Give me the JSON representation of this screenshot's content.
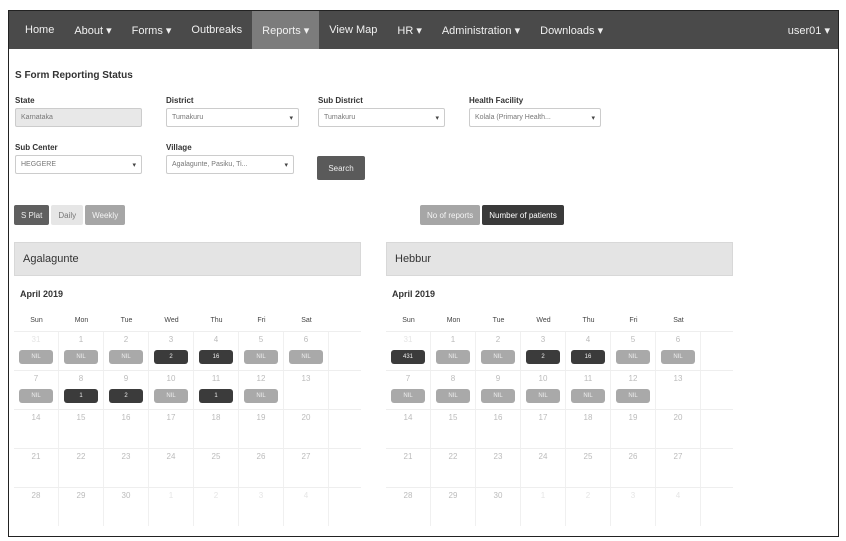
{
  "nav": {
    "items": [
      "Home",
      "About ▾",
      "Forms ▾",
      "Outbreaks",
      "Reports ▾",
      "View Map",
      "HR ▾",
      "Administration ▾",
      "Downloads ▾"
    ],
    "active_index": 4,
    "user": "user01 ▾"
  },
  "page": {
    "title": "S Form Reporting Status"
  },
  "form": {
    "state": {
      "label": "State",
      "value": "Karnataka"
    },
    "district": {
      "label": "District",
      "value": "Tumakuru"
    },
    "sub_district": {
      "label": "Sub District",
      "value": "Tumakuru"
    },
    "health_facility": {
      "label": "Health Facility",
      "value": "Kolala (Primary Health..."
    },
    "sub_center": {
      "label": "Sub Center",
      "value": "HEGGERE"
    },
    "village": {
      "label": "Village",
      "value": "Agalagunte, Pasiku, Ti..."
    },
    "search_label": "Search"
  },
  "view_toggle": [
    "S Plat",
    "Daily",
    "Weekly"
  ],
  "metric_toggle": [
    "No of reports",
    "Number of patients"
  ],
  "colors": {
    "nav_bg": "#4a4a4a",
    "badge_dark": "#3b3b3b",
    "badge_light": "#a9a9a9"
  },
  "calendars": [
    {
      "name": "Agalagunte",
      "month": "April 2019",
      "dow": [
        "Sun",
        "Mon",
        "Tue",
        "Wed",
        "Thu",
        "Fri",
        "Sat"
      ],
      "weeks": [
        [
          {
            "n": "31",
            "other": true,
            "badge": "NIL",
            "style": "light"
          },
          {
            "n": "1",
            "badge": "NIL",
            "style": "light"
          },
          {
            "n": "2",
            "badge": "NIL",
            "style": "light"
          },
          {
            "n": "3",
            "badge": "2",
            "style": "dark"
          },
          {
            "n": "4",
            "badge": "16",
            "style": "dark"
          },
          {
            "n": "5",
            "badge": "NIL",
            "style": "light"
          },
          {
            "n": "6",
            "badge": "NIL",
            "style": "light"
          }
        ],
        [
          {
            "n": "7",
            "badge": "NIL",
            "style": "light"
          },
          {
            "n": "8",
            "badge": "1",
            "style": "dark"
          },
          {
            "n": "9",
            "badge": "2",
            "style": "dark"
          },
          {
            "n": "10",
            "badge": "NIL",
            "style": "light"
          },
          {
            "n": "11",
            "badge": "1",
            "style": "dark"
          },
          {
            "n": "12",
            "badge": "NIL",
            "style": "light"
          },
          {
            "n": "13"
          }
        ],
        [
          {
            "n": "14"
          },
          {
            "n": "15"
          },
          {
            "n": "16"
          },
          {
            "n": "17"
          },
          {
            "n": "18"
          },
          {
            "n": "19"
          },
          {
            "n": "20"
          }
        ],
        [
          {
            "n": "21"
          },
          {
            "n": "22"
          },
          {
            "n": "23"
          },
          {
            "n": "24"
          },
          {
            "n": "25"
          },
          {
            "n": "26"
          },
          {
            "n": "27"
          }
        ],
        [
          {
            "n": "28"
          },
          {
            "n": "29"
          },
          {
            "n": "30"
          },
          {
            "n": "1",
            "other": true
          },
          {
            "n": "2",
            "other": true
          },
          {
            "n": "3",
            "other": true
          },
          {
            "n": "4",
            "other": true
          }
        ]
      ]
    },
    {
      "name": "Hebbur",
      "month": "April 2019",
      "dow": [
        "Sun",
        "Mon",
        "Tue",
        "Wed",
        "Thu",
        "Fri",
        "Sat"
      ],
      "weeks": [
        [
          {
            "n": "31",
            "other": true,
            "badge": "431",
            "style": "dark"
          },
          {
            "n": "1",
            "badge": "NIL",
            "style": "light"
          },
          {
            "n": "2",
            "badge": "NIL",
            "style": "light"
          },
          {
            "n": "3",
            "badge": "2",
            "style": "dark"
          },
          {
            "n": "4",
            "badge": "16",
            "style": "dark"
          },
          {
            "n": "5",
            "badge": "NIL",
            "style": "light"
          },
          {
            "n": "6",
            "badge": "NIL",
            "style": "light"
          }
        ],
        [
          {
            "n": "7",
            "badge": "NIL",
            "style": "light"
          },
          {
            "n": "8",
            "badge": "NIL",
            "style": "light"
          },
          {
            "n": "9",
            "badge": "NIL",
            "style": "light"
          },
          {
            "n": "10",
            "badge": "NIL",
            "style": "light"
          },
          {
            "n": "11",
            "badge": "NIL",
            "style": "light"
          },
          {
            "n": "12",
            "badge": "NIL",
            "style": "light"
          },
          {
            "n": "13"
          }
        ],
        [
          {
            "n": "14"
          },
          {
            "n": "15"
          },
          {
            "n": "16"
          },
          {
            "n": "17"
          },
          {
            "n": "18"
          },
          {
            "n": "19"
          },
          {
            "n": "20"
          }
        ],
        [
          {
            "n": "21"
          },
          {
            "n": "22"
          },
          {
            "n": "23"
          },
          {
            "n": "24"
          },
          {
            "n": "25"
          },
          {
            "n": "26"
          },
          {
            "n": "27"
          }
        ],
        [
          {
            "n": "28"
          },
          {
            "n": "29"
          },
          {
            "n": "30"
          },
          {
            "n": "1",
            "other": true
          },
          {
            "n": "2",
            "other": true
          },
          {
            "n": "3",
            "other": true
          },
          {
            "n": "4",
            "other": true
          }
        ]
      ]
    }
  ]
}
